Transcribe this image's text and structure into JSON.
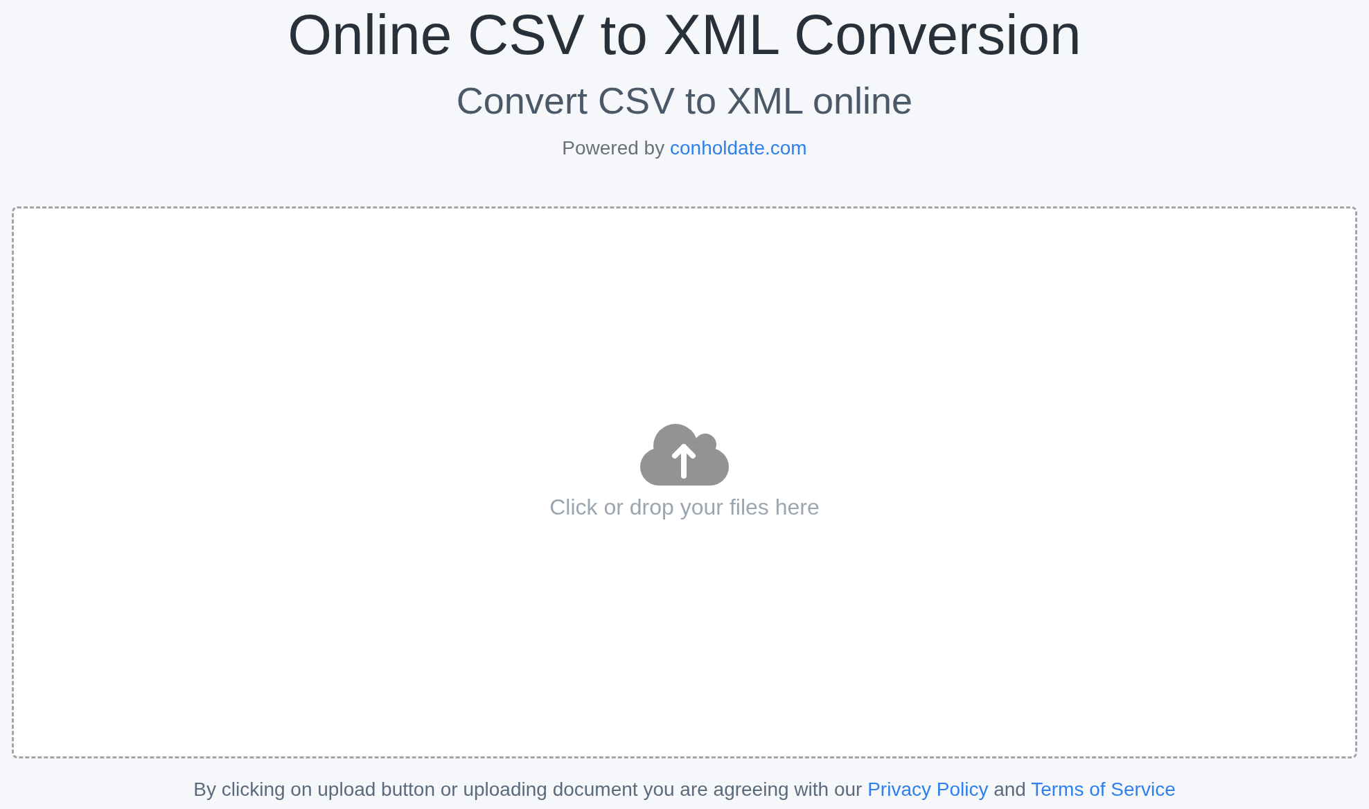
{
  "header": {
    "title": "Online CSV to XML Conversion",
    "subtitle": "Convert CSV to XML online",
    "powered_by": [
      {
        "kind": "text",
        "text": "Powered by"
      },
      {
        "kind": "link",
        "text": "conholdate.com"
      }
    ]
  },
  "upload_area": {
    "prompt": "Click or drop your files here"
  },
  "footer_note": [
    {
      "kind": "text",
      "text": "By clicking on upload button or uploading document you are agreeing with our"
    },
    {
      "kind": "link",
      "text": "Privacy Policy"
    },
    {
      "kind": "text",
      "text": "and"
    },
    {
      "kind": "link",
      "text": "Terms of Service"
    }
  ]
}
